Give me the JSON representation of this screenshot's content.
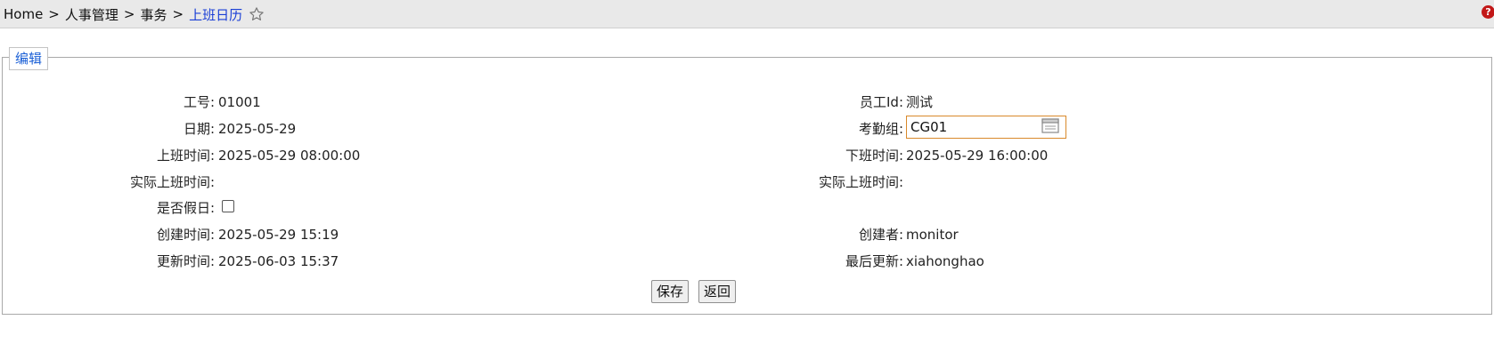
{
  "breadcrumb": {
    "items": [
      "Home",
      "人事管理",
      "事务"
    ],
    "current": "上班日历",
    "separator": ">"
  },
  "section_legend": "编辑",
  "fields": {
    "emp_no": {
      "label": "工号:",
      "value": "01001"
    },
    "employee_id": {
      "label": "员工Id:",
      "value": "测试"
    },
    "date": {
      "label": "日期:",
      "value": "2025-05-29"
    },
    "attendance_group": {
      "label": "考勤组:",
      "value": "CG01"
    },
    "start_time": {
      "label": "上班时间:",
      "value": "2025-05-29 08:00:00"
    },
    "end_time": {
      "label": "下班时间:",
      "value": "2025-05-29 16:00:00"
    },
    "actual_start": {
      "label": "实际上班时间:",
      "value": ""
    },
    "actual_start_2": {
      "label": "实际上班时间:",
      "value": ""
    },
    "is_holiday": {
      "label": "是否假日:",
      "checked": false
    },
    "created_at": {
      "label": "创建时间:",
      "value": "2025-05-29 15:19"
    },
    "created_by": {
      "label": "创建者:",
      "value": "monitor"
    },
    "updated_at": {
      "label": "更新时间:",
      "value": "2025-06-03 15:37"
    },
    "updated_by": {
      "label": "最后更新:",
      "value": "xiahonghao"
    }
  },
  "buttons": {
    "save": "保存",
    "back": "返回"
  },
  "colors": {
    "accent": "#1a3fd6",
    "input_border": "#d9892b",
    "help": "#c21818"
  },
  "icons": {
    "favorite": "star-outline-icon",
    "help": "help-icon",
    "lookup": "lookup-list-icon"
  }
}
